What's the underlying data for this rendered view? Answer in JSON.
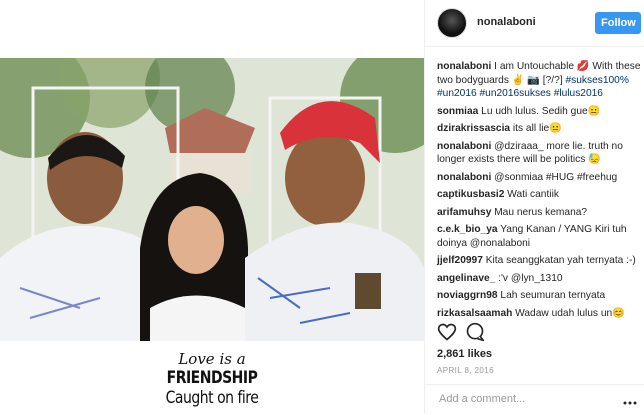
{
  "post": {
    "caption_art": {
      "line1": "Love is a",
      "line2": "FRIENDSHIP",
      "line3": "Caught on fire"
    }
  },
  "header": {
    "username": "nonalaboni",
    "follow_label": "Follow"
  },
  "comments": [
    {
      "user": "nonalaboni",
      "text": " I am Untouchable 💋 With these two bodyguards ✌ 📷 [?/?]",
      "tags": "#sukses100% #un2016 #un2016sukses #lulus2016"
    },
    {
      "user": "sonmiaa",
      "text": " Lu udh lulus. Sedih gue😐"
    },
    {
      "user": "dzirakrissascia",
      "text": " its all lie😐"
    },
    {
      "user": "nonalaboni",
      "text": " @dziraaa_ more lie. truth no longer exists there will be politics 😓"
    },
    {
      "user": "nonalaboni",
      "text": " @sonmiaa #HUG #freehug"
    },
    {
      "user": "captikusbasi2",
      "text": " Wati cantiik"
    },
    {
      "user": "arifamuhsy",
      "text": " Mau nerus kemana?"
    },
    {
      "user": "c.e.k_bio_ya",
      "text": " Yang Kanan / YANG Kiri tuh doinya @nonalaboni"
    },
    {
      "user": "jjelf20997",
      "text": " Kita seanggkatan yah ternyata :-)"
    },
    {
      "user": "angelinave_",
      "text": " :'v @lyn_1310"
    },
    {
      "user": "noviaggrn98",
      "text": " Lah seumuran ternyata"
    },
    {
      "user": "rizkasalsaamah",
      "text": " Wadaw udah lulus un😊"
    }
  ],
  "actions": {
    "icons": [
      "heart-icon",
      "comment-icon"
    ],
    "likes": "2,861 likes",
    "date": "APRIL 8, 2016"
  },
  "add_comment": {
    "placeholder": "Add a comment..."
  },
  "colors": {
    "follow_button": "#3897f0",
    "hashtag": "#003569",
    "text": "#262626",
    "muted": "#999999",
    "cap_red": "#d9323a"
  }
}
